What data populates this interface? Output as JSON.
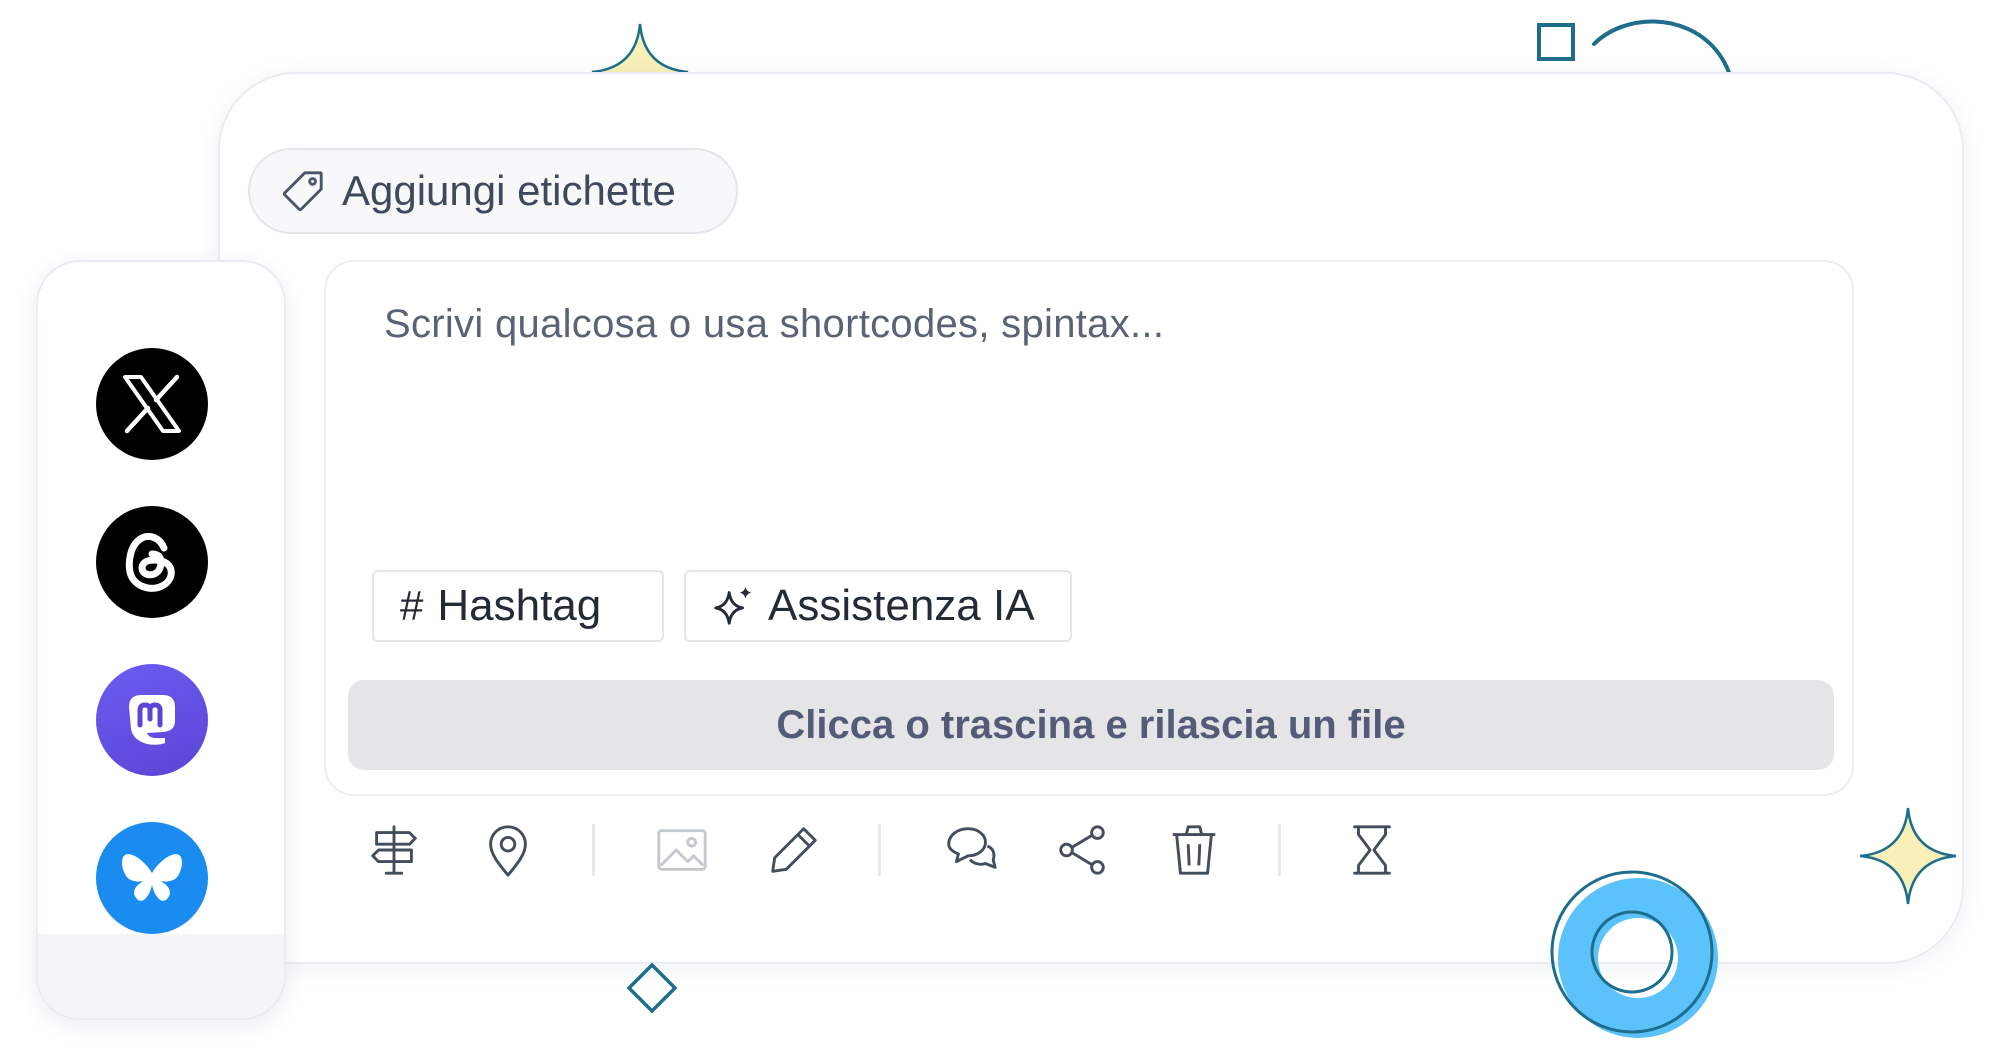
{
  "labels": {
    "add_label": "Aggiungi etichette",
    "icon": "tag-icon"
  },
  "networks": [
    {
      "name": "X",
      "icon": "x-logo-icon"
    },
    {
      "name": "Threads",
      "icon": "threads-logo-icon"
    },
    {
      "name": "Mastodon",
      "icon": "mastodon-logo-icon"
    },
    {
      "name": "Bluesky",
      "icon": "bluesky-logo-icon"
    }
  ],
  "editor": {
    "placeholder": "Scrivi qualcosa o usa shortcodes, spintax...",
    "chips": {
      "hashtag": {
        "symbol": "#",
        "label": "Hashtag"
      },
      "ai": {
        "label": "Assistenza IA",
        "icon": "sparkles-icon"
      }
    },
    "upload": "Clicca o trascina e rilascia un file"
  },
  "toolbar": [
    "signpost-icon",
    "location-pin-icon",
    "image-icon",
    "pencil-icon",
    "comments-icon",
    "share-icon",
    "trash-icon",
    "hourglass-icon"
  ],
  "colors": {
    "accent": "#1d6e8c",
    "sparkle_fill": "#f8f0b8",
    "ring": "#5bc2fb",
    "mastodon": "#5b45d6",
    "bluesky": "#1a8cf0",
    "upload_text": "#545b78"
  }
}
